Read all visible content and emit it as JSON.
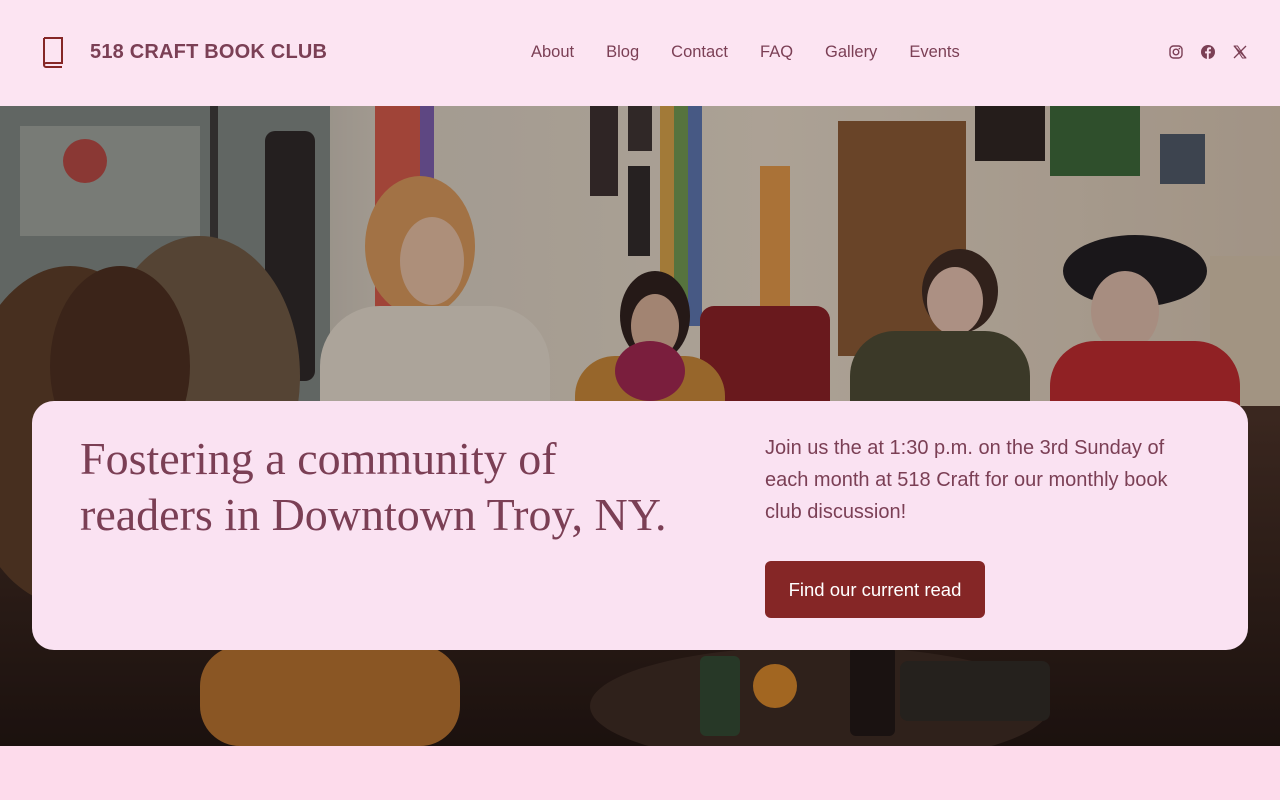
{
  "site": {
    "name": "518 CRAFT BOOK CLUB",
    "brand_icon": "book-icon"
  },
  "nav": {
    "items": [
      {
        "label": "About"
      },
      {
        "label": "Blog"
      },
      {
        "label": "Contact"
      },
      {
        "label": "FAQ"
      },
      {
        "label": "Gallery"
      },
      {
        "label": "Events"
      }
    ]
  },
  "social": {
    "icons": [
      "instagram-icon",
      "facebook-icon",
      "x-icon"
    ]
  },
  "hero": {
    "heading": "Fostering a community of readers in Downtown Troy, NY.",
    "description": "Join us the at 1:30 p.m. on the 3rd Sunday of each month at 518 Craft for our monthly book club discussion!",
    "cta_label": "Find our current read"
  },
  "colors": {
    "page_background": "#fbdcec",
    "header_background": "#fce4f2",
    "card_background": "#fae2f2",
    "text": "#7b3f55",
    "button": "#852626",
    "button_text": "#ffffff"
  }
}
